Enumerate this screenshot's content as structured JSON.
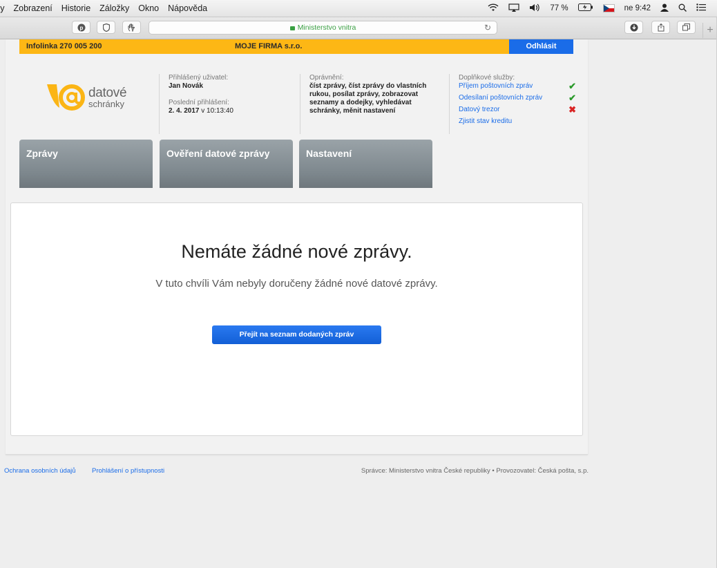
{
  "menubar": {
    "items": [
      "vy",
      "Zobrazení",
      "Historie",
      "Záložky",
      "Okno",
      "Nápověda"
    ],
    "battery": "77 %",
    "time": "ne 9:42"
  },
  "toolbar": {
    "address": "Ministerstvo vnitra"
  },
  "topbar": {
    "phone": "Infolinka 270 005 200",
    "company": "MOJE FIRMA s.r.o.",
    "logout": "Odhlásit"
  },
  "logo": {
    "line1": "datové",
    "line2": "schránky",
    "colors": {
      "orange": "#fbb515",
      "gray": "#666666"
    }
  },
  "user": {
    "label": "Přihlášený uživatel:",
    "name": "Jan Novák",
    "last_login_label": "Poslední přihlášení:",
    "last_login_date": "2. 4. 2017",
    "last_login_time": "v 10:13:40"
  },
  "permissions": {
    "label": "Oprávnění:",
    "text": "číst zprávy, číst zprávy do vlastních rukou, posílat zprávy, zobrazovat seznamy a dodejky, vyhledávat schránky, měnit nastavení"
  },
  "services": {
    "label": "Doplňkové služby:",
    "items": [
      {
        "label": "Příjem poštovních zpráv",
        "status": "ok"
      },
      {
        "label": "Odesílaní poštovních zpráv",
        "status": "ok"
      },
      {
        "label": "Datový trezor",
        "status": "no"
      },
      {
        "label": "Zjistit stav kreditu",
        "status": "none"
      }
    ],
    "ok_mark": "✔",
    "no_mark": "✖"
  },
  "tabs": [
    "Zprávy",
    "Ověření datové zprávy",
    "Nastavení"
  ],
  "content": {
    "heading": "Nemáte žádné nové zprávy.",
    "subtext": "V tuto chvíli Vám nebyly doručeny žádné nové datové zprávy.",
    "button": "Přejít na seznam dodaných zpráv"
  },
  "footer": {
    "privacy": "Ochrana osobních údajů",
    "accessibility": "Prohlášení o přístupnosti",
    "credits": "Správce: Ministerstvo vnitra České republiky • Provozovatel: Česká pošta, s.p."
  },
  "colors": {
    "accent_yellow": "#fdb715",
    "accent_blue": "#1a6ce8",
    "tab_gray": "#7d878d"
  }
}
